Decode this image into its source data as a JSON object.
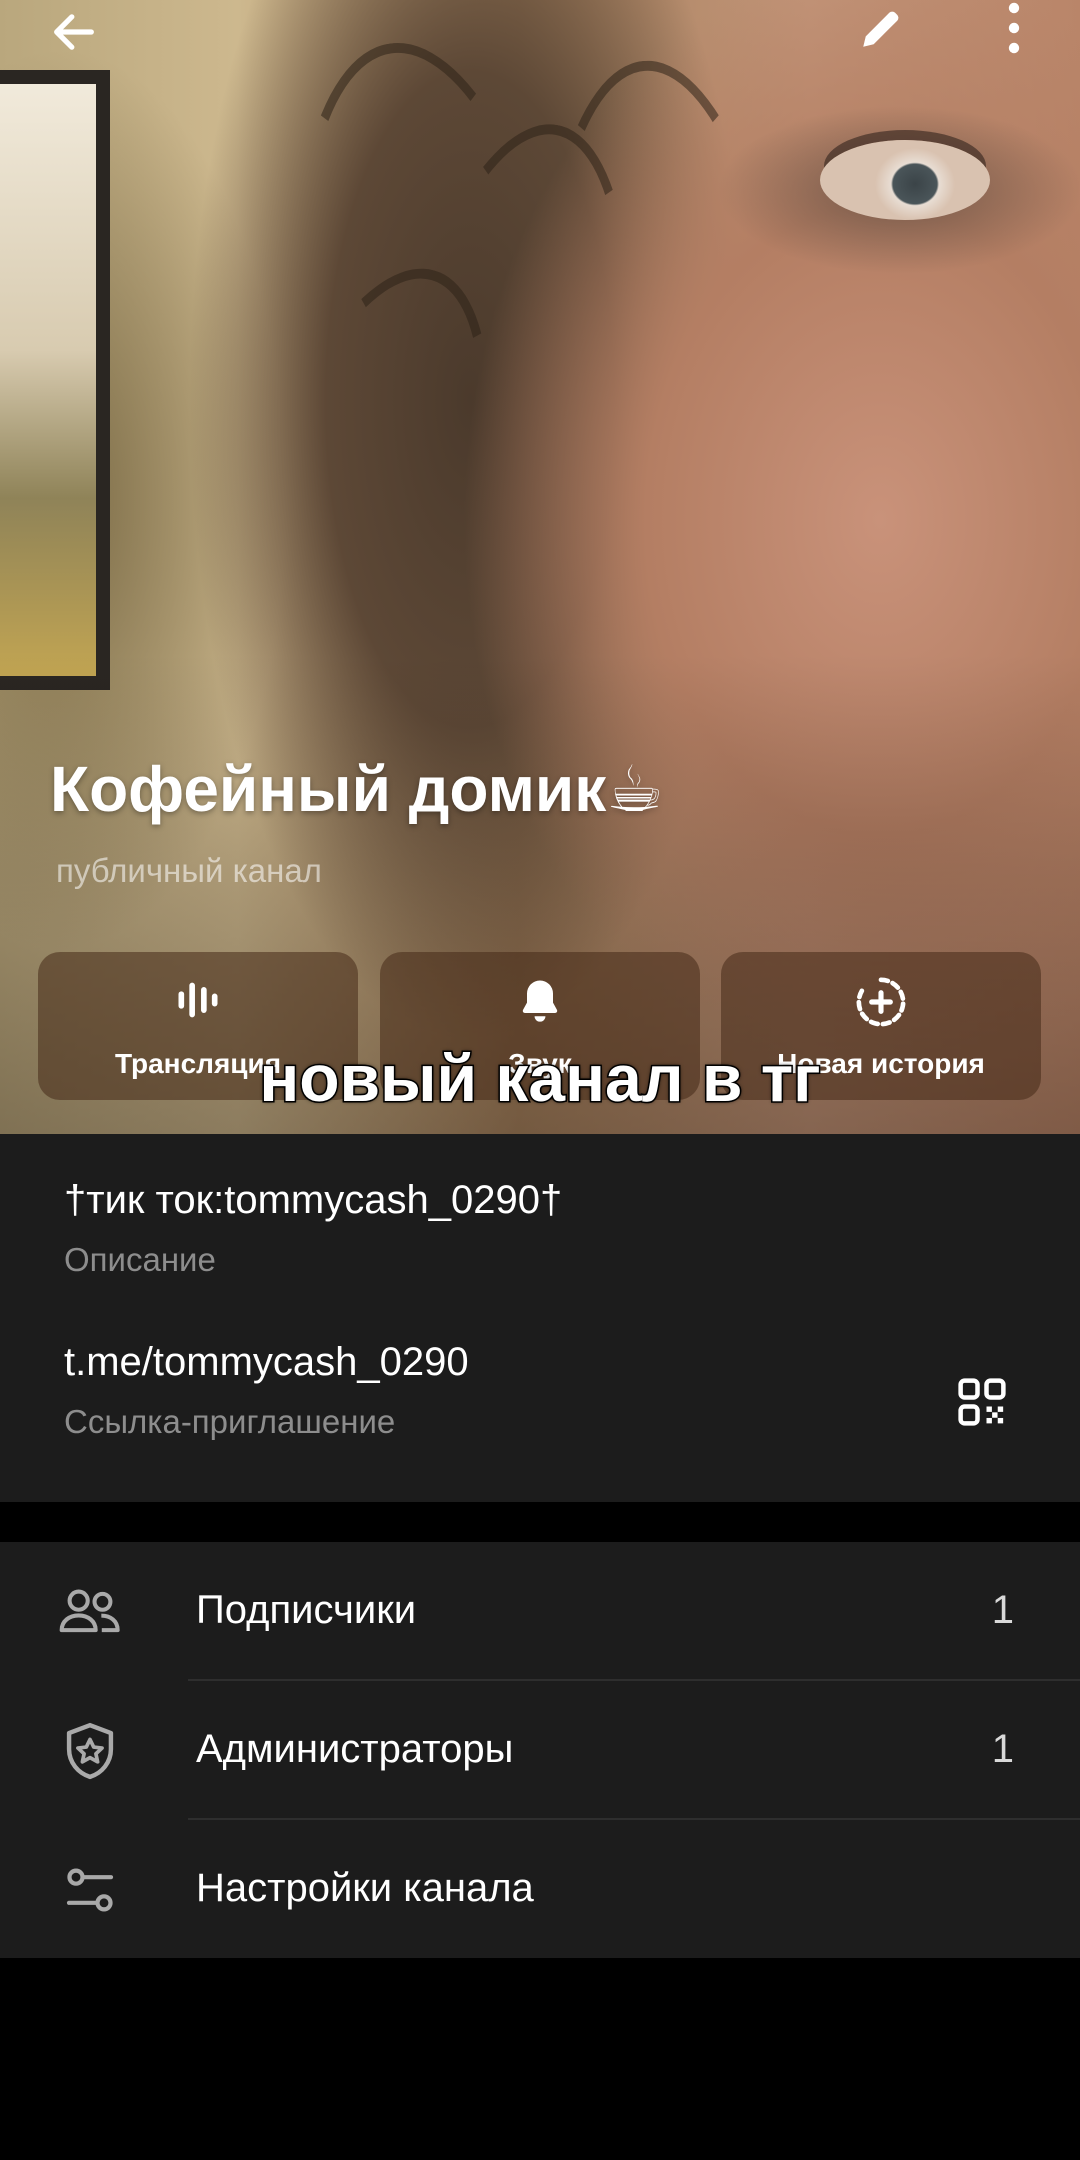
{
  "channel": {
    "title": "Кофейный домик☕",
    "subtitle": "публичный канал"
  },
  "top_bar": {
    "back_icon": "arrow-left-icon",
    "edit_icon": "pencil-icon",
    "more_icon": "more-vertical-icon"
  },
  "actions": [
    {
      "label": "Трансляция",
      "icon": "broadcast-icon"
    },
    {
      "label": "Звук",
      "icon": "bell-icon"
    },
    {
      "label": "Новая история",
      "icon": "story-add-icon"
    }
  ],
  "overlay_caption": "новый канал в тг",
  "info": {
    "description_value": "†тик ток:tommycash_0290†",
    "description_caption": "Описание",
    "link_value": "t.me/tommycash_0290",
    "link_caption": "Ссылка-приглашение",
    "qr_icon": "qr-code-icon"
  },
  "menu": {
    "subscribers": {
      "label": "Подписчики",
      "count": "1",
      "icon": "users-icon"
    },
    "admins": {
      "label": "Администраторы",
      "count": "1",
      "icon": "shield-star-icon"
    },
    "settings": {
      "label": "Настройки канала",
      "icon": "sliders-icon"
    }
  },
  "colors": {
    "card_background": "#1c1c1c",
    "secondary_text": "#8d8d8d",
    "page_background": "#000000"
  }
}
